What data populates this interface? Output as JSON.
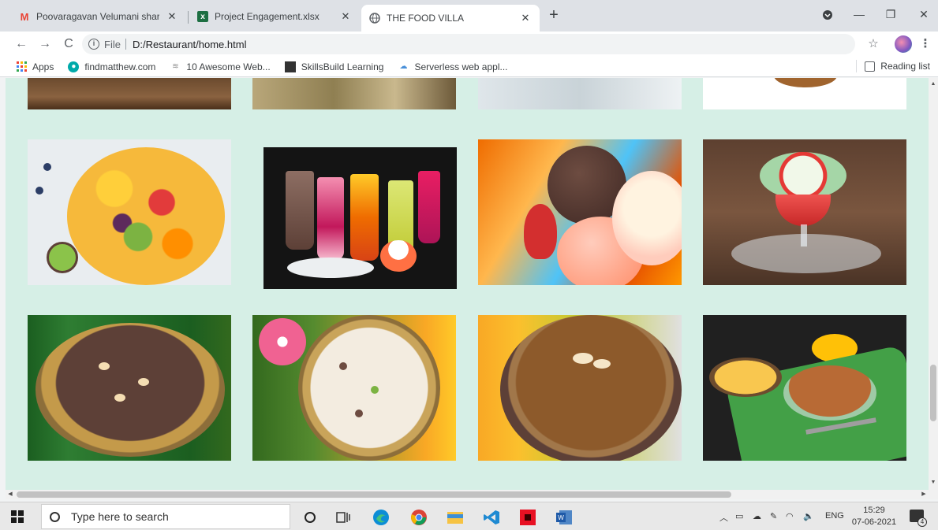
{
  "tabs": [
    {
      "title": "Poovaragavan Velumani shared",
      "favicon": "gmail-icon",
      "active": false
    },
    {
      "title": "Project Engagement.xlsx",
      "favicon": "excel-icon",
      "active": false
    },
    {
      "title": "THE FOOD VILLA",
      "favicon": "globe-icon",
      "active": true
    }
  ],
  "toolbar": {
    "scheme_label": "File",
    "url": "D:/Restaurant/home.html"
  },
  "bookmarks": [
    {
      "label": "Apps",
      "icon": "apps-grid-icon"
    },
    {
      "label": "findmatthew.com",
      "icon": "site-icon"
    },
    {
      "label": "10 Awesome Web...",
      "icon": "site-icon"
    },
    {
      "label": "SkillsBuild Learning",
      "icon": "site-icon"
    },
    {
      "label": "Serverless web appl...",
      "icon": "cloud-icon"
    }
  ],
  "reading_list_label": "Reading list",
  "gallery": {
    "images": [
      {
        "name": "food-image-row1-1",
        "desc": "top row partial"
      },
      {
        "name": "food-image-row1-2",
        "desc": "top row partial"
      },
      {
        "name": "food-image-row1-3",
        "desc": "top row partial"
      },
      {
        "name": "food-image-row1-4",
        "desc": "top row partial"
      },
      {
        "name": "fruit-salad-image"
      },
      {
        "name": "falooda-drinks-image"
      },
      {
        "name": "ice-cream-scoops-image"
      },
      {
        "name": "sundae-cup-image"
      },
      {
        "name": "payasam-brass-pot-image"
      },
      {
        "name": "kheer-bowl-image"
      },
      {
        "name": "chocolate-payasam-image"
      },
      {
        "name": "dal-payasam-image"
      }
    ]
  },
  "taskbar": {
    "search_placeholder": "Type here to search",
    "lang": "ENG",
    "time": "15:29",
    "date": "07-06-2021",
    "notification_count": "4"
  },
  "colors": {
    "page_background": "#d6efe6",
    "tabstrip": "#dee1e6"
  }
}
